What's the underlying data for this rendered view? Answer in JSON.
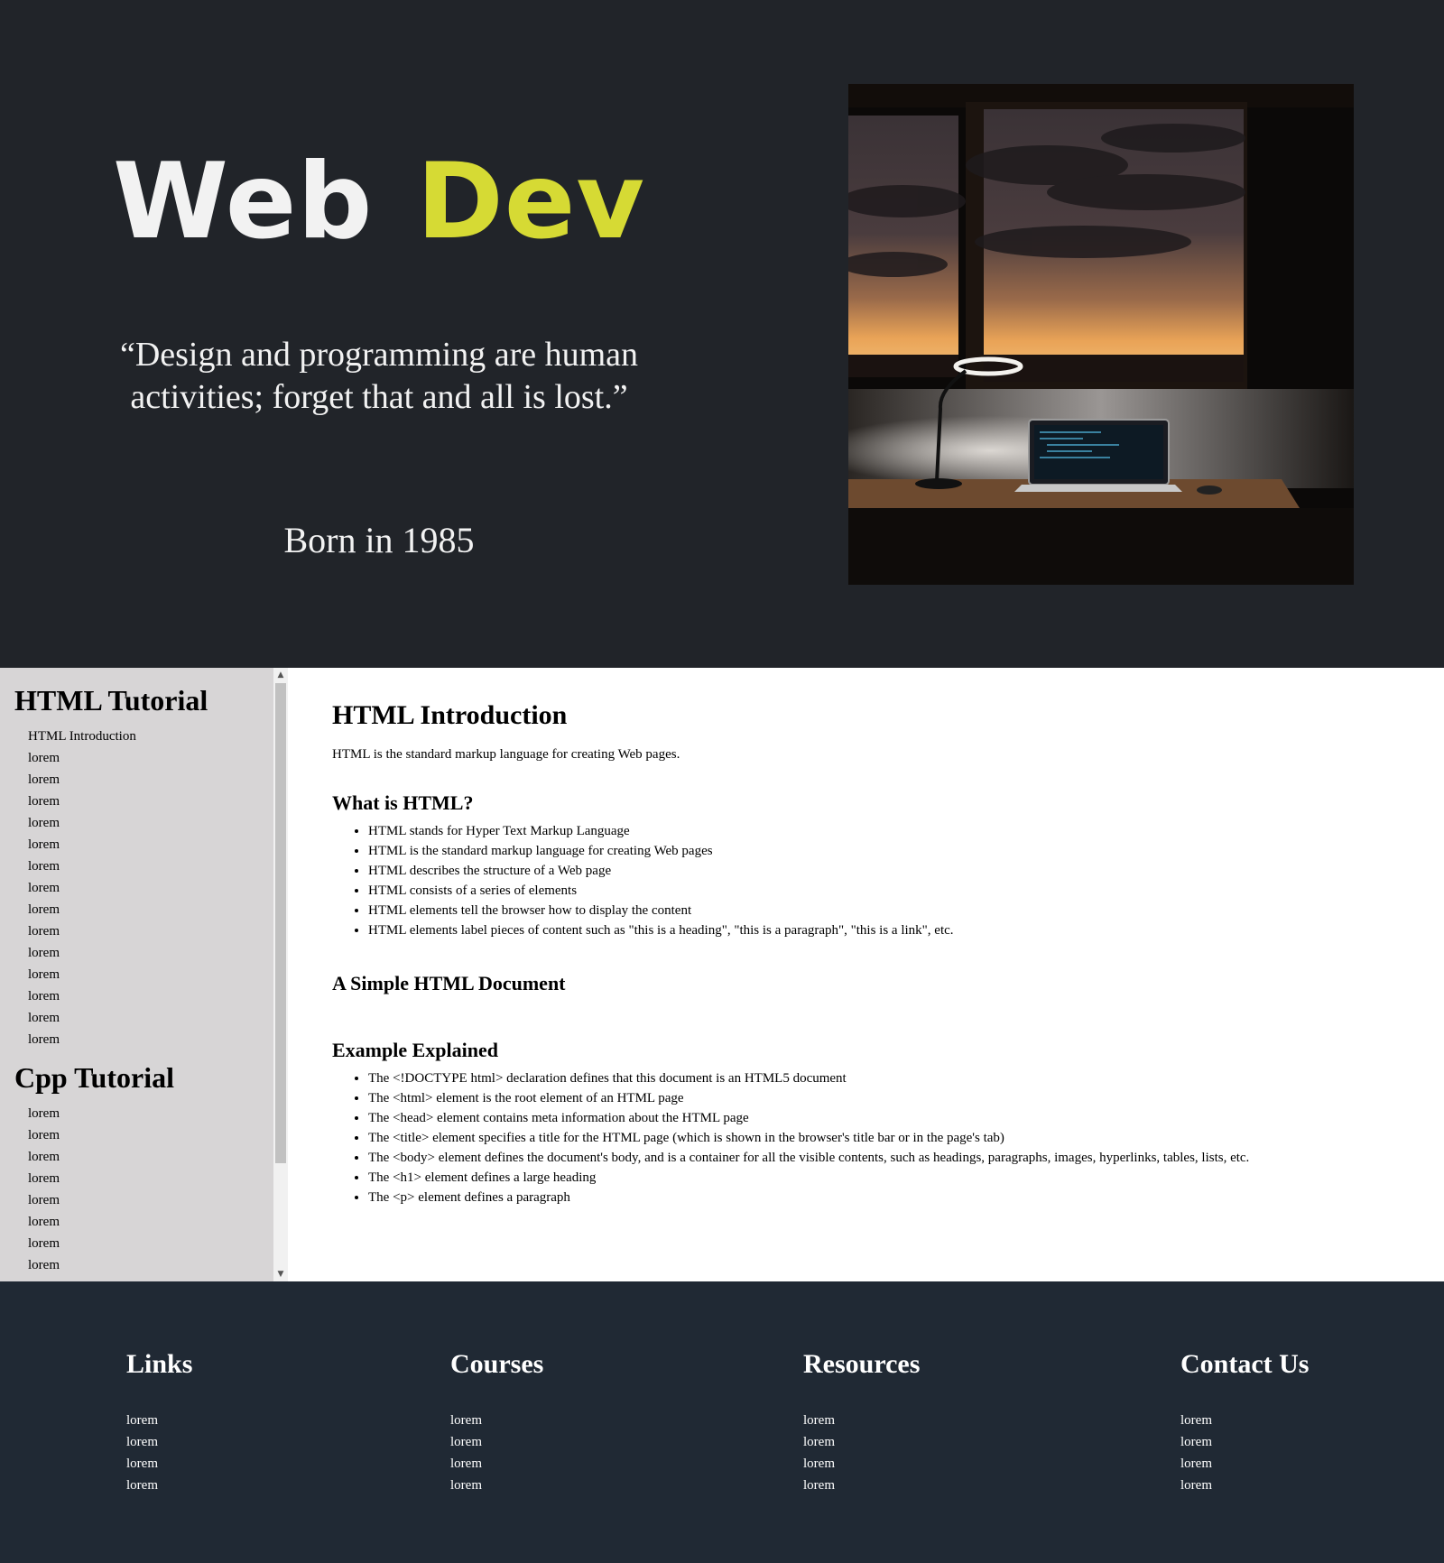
{
  "hero": {
    "brand_part1": "Web",
    "brand_part2": "Dev",
    "quote": "“Design and programming are human activities; forget that and all is lost.”",
    "born": "Born in 1985",
    "colors": {
      "background": "#212429",
      "accent": "#d6da34",
      "text": "#f2f2f2"
    }
  },
  "sidebar": {
    "sections": [
      {
        "title": "HTML Tutorial",
        "items": [
          "HTML Introduction",
          "lorem",
          "lorem",
          "lorem",
          "lorem",
          "lorem",
          "lorem",
          "lorem",
          "lorem",
          "lorem",
          "lorem",
          "lorem",
          "lorem",
          "lorem",
          "lorem"
        ]
      },
      {
        "title": "Cpp Tutorial",
        "items": [
          "lorem",
          "lorem",
          "lorem",
          "lorem",
          "lorem",
          "lorem",
          "lorem",
          "lorem"
        ]
      }
    ]
  },
  "content": {
    "title": "HTML Introduction",
    "intro": "HTML is the standard markup language for creating Web pages.",
    "what_heading": "What is HTML?",
    "what_items": [
      "HTML stands for Hyper Text Markup Language",
      "HTML is the standard markup language for creating Web pages",
      "HTML describes the structure of a Web page",
      "HTML consists of a series of elements",
      "HTML elements tell the browser how to display the content",
      "HTML elements label pieces of content such as \"this is a heading\", \"this is a paragraph\", \"this is a link\", etc."
    ],
    "simple_heading": "A Simple HTML Document",
    "example_heading": "Example Explained",
    "example_items": [
      "The <!DOCTYPE html> declaration defines that this document is an HTML5 document",
      "The <html> element is the root element of an HTML page",
      "The <head> element contains meta information about the HTML page",
      "The <title> element specifies a title for the HTML page (which is shown in the browser's title bar or in the page's tab)",
      "The <body> element defines the document's body, and is a container for all the visible contents, such as headings, paragraphs, images, hyperlinks, tables, lists, etc.",
      "The <h1> element defines a large heading",
      "The <p> element defines a paragraph"
    ]
  },
  "footer": {
    "columns": [
      {
        "title": "Links",
        "items": [
          "lorem",
          "lorem",
          "lorem",
          "lorem"
        ]
      },
      {
        "title": "Courses",
        "items": [
          "lorem",
          "lorem",
          "lorem",
          "lorem"
        ]
      },
      {
        "title": "Resources",
        "items": [
          "lorem",
          "lorem",
          "lorem",
          "lorem"
        ]
      },
      {
        "title": "Contact Us",
        "items": [
          "lorem",
          "lorem",
          "lorem",
          "lorem"
        ]
      }
    ],
    "colors": {
      "background": "#202934"
    }
  }
}
